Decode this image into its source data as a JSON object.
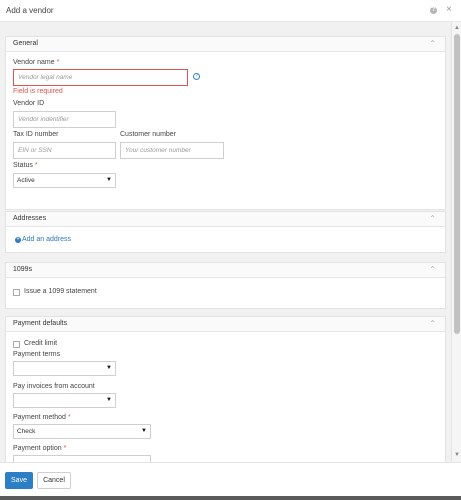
{
  "dialog": {
    "title": "Add a vendor",
    "help_icon": "question-icon",
    "close_icon": "×"
  },
  "general": {
    "title": "General",
    "vendor_name_label": "Vendor name",
    "required_mark": "*",
    "vendor_name_placeholder": "Vendor legal name",
    "vendor_name_error": "Field is required",
    "vendor_id_label": "Vendor ID",
    "vendor_id_placeholder": "Vendor indentifier",
    "tax_id_label": "Tax ID number",
    "tax_id_placeholder": "EIN or SSN",
    "customer_number_label": "Customer number",
    "customer_number_placeholder": "Your customer number",
    "status_label": "Status",
    "status_value": "Active"
  },
  "addresses": {
    "title": "Addresses",
    "add_link": "Add an address"
  },
  "form1099": {
    "title": "1099s",
    "issue_label": "Issue a 1099 statement"
  },
  "payment": {
    "title": "Payment defaults",
    "credit_limit_label": "Credit limit",
    "payment_terms_label": "Payment terms",
    "payment_terms_value": "",
    "pay_from_label": "Pay invoices from account",
    "pay_from_value": "",
    "method_label": "Payment method",
    "method_value": "Check",
    "option_label": "Payment option"
  },
  "footer": {
    "save_label": "Save",
    "cancel_label": "Cancel"
  },
  "colors": {
    "accent": "#2c7fc4",
    "error": "#d9534f",
    "link": "#2a78c2"
  }
}
